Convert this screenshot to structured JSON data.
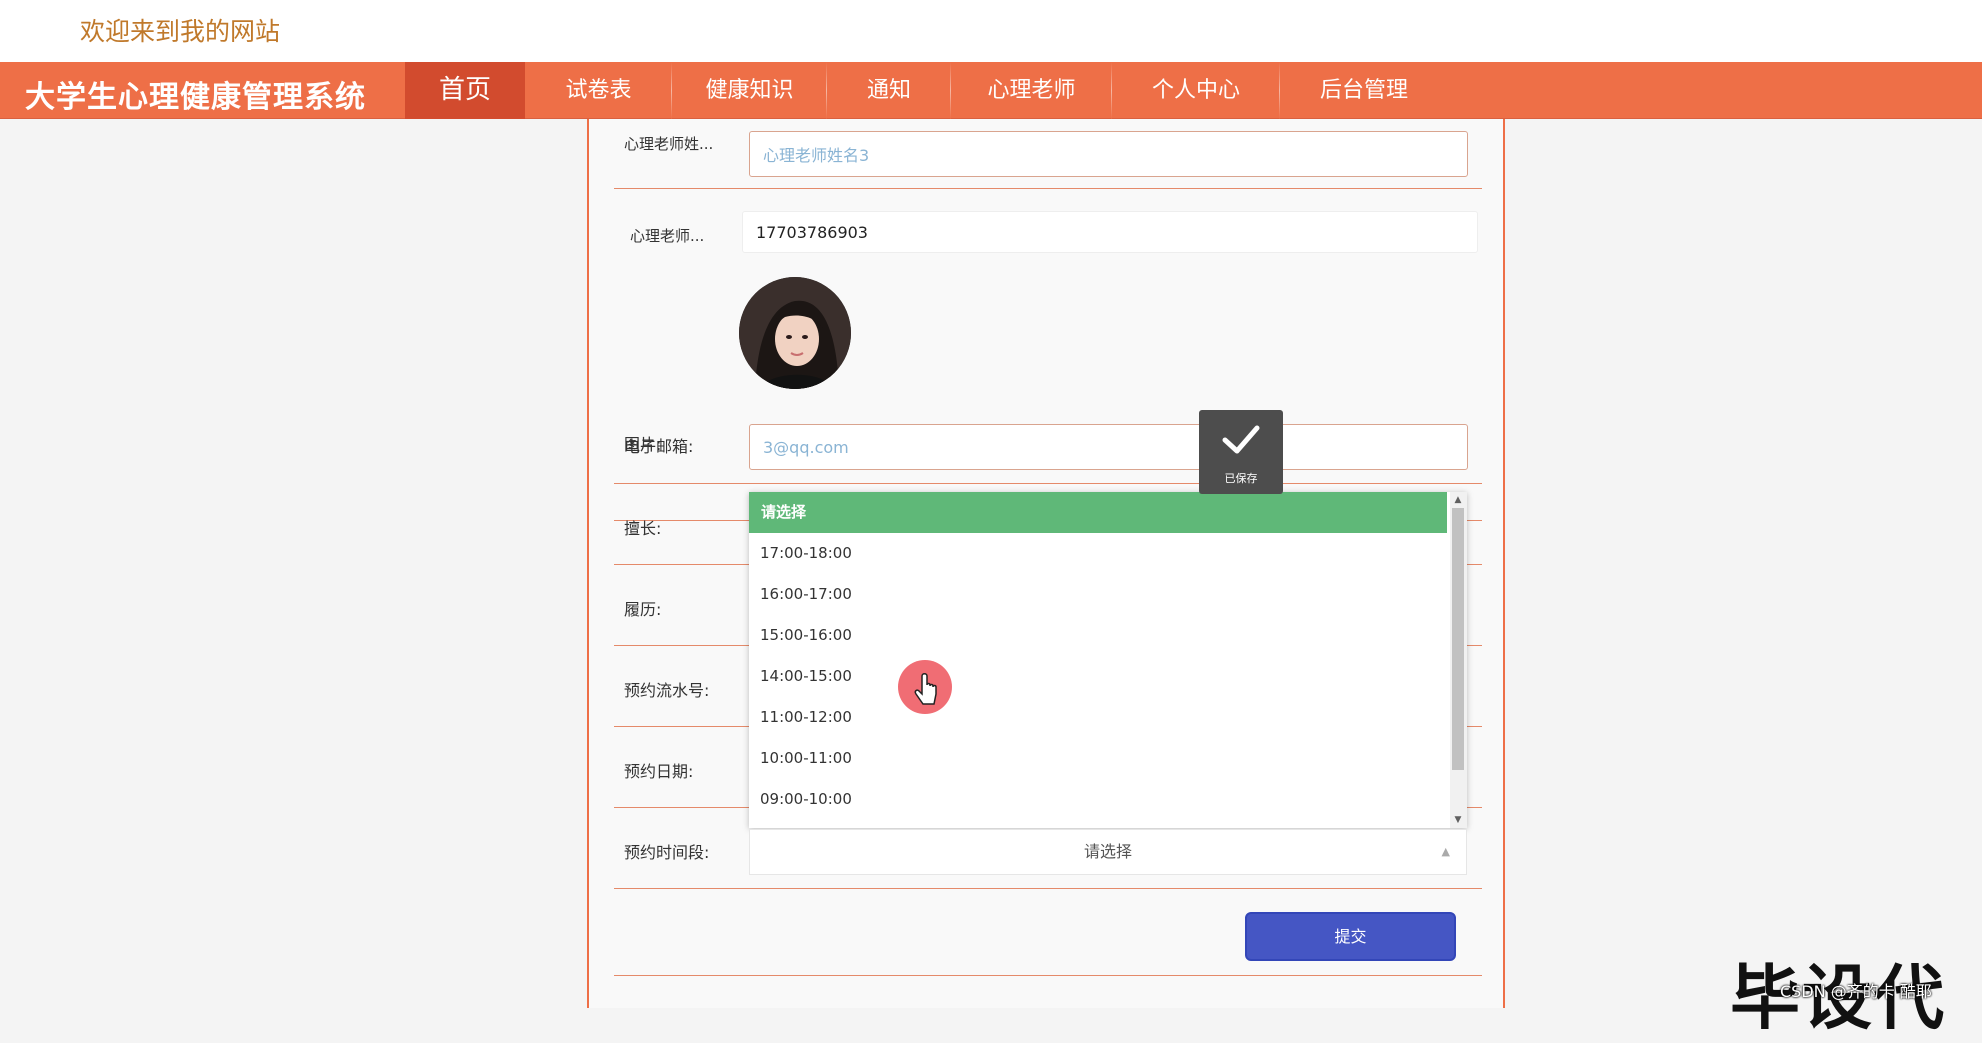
{
  "header": {
    "welcome": "欢迎来到我的网站"
  },
  "nav": {
    "brand": "大学生心理健康管理系统",
    "items": [
      {
        "label": "首页",
        "active": true
      },
      {
        "label": "试卷表",
        "active": false
      },
      {
        "label": "健康知识",
        "active": false
      },
      {
        "label": "通知",
        "active": false
      },
      {
        "label": "心理老师",
        "active": false
      },
      {
        "label": "个人中心",
        "active": false
      },
      {
        "label": "后台管理",
        "active": false
      }
    ]
  },
  "form": {
    "teacher_name": {
      "label": "心理老师姓...",
      "placeholder": "心理老师姓名3"
    },
    "teacher_phone": {
      "label": "心理老师...",
      "value": "17703786903"
    },
    "image": {
      "label": "图片:"
    },
    "email": {
      "label": "电子邮箱:",
      "placeholder": "3@qq.com"
    },
    "specialty": {
      "label": "擅长:"
    },
    "resume": {
      "label": "履历:"
    },
    "serial": {
      "label": "预约流水号:"
    },
    "date": {
      "label": "预约日期:"
    },
    "time_slot": {
      "label": "预约时间段:",
      "selected": "请选择",
      "options": [
        "请选择",
        "17:00-18:00",
        "16:00-17:00",
        "15:00-16:00",
        "14:00-15:00",
        "11:00-12:00",
        "10:00-11:00",
        "09:00-10:00"
      ]
    },
    "submit_label": "提交"
  },
  "toast": {
    "text": "已保存"
  },
  "watermark": {
    "big": "毕设代",
    "small": "CSDN @齐的卡 酷耶"
  },
  "colors": {
    "nav": "#ee6f47",
    "nav_active": "#d24b2e",
    "option_highlight": "#5fb878",
    "submit": "#4556c4"
  }
}
